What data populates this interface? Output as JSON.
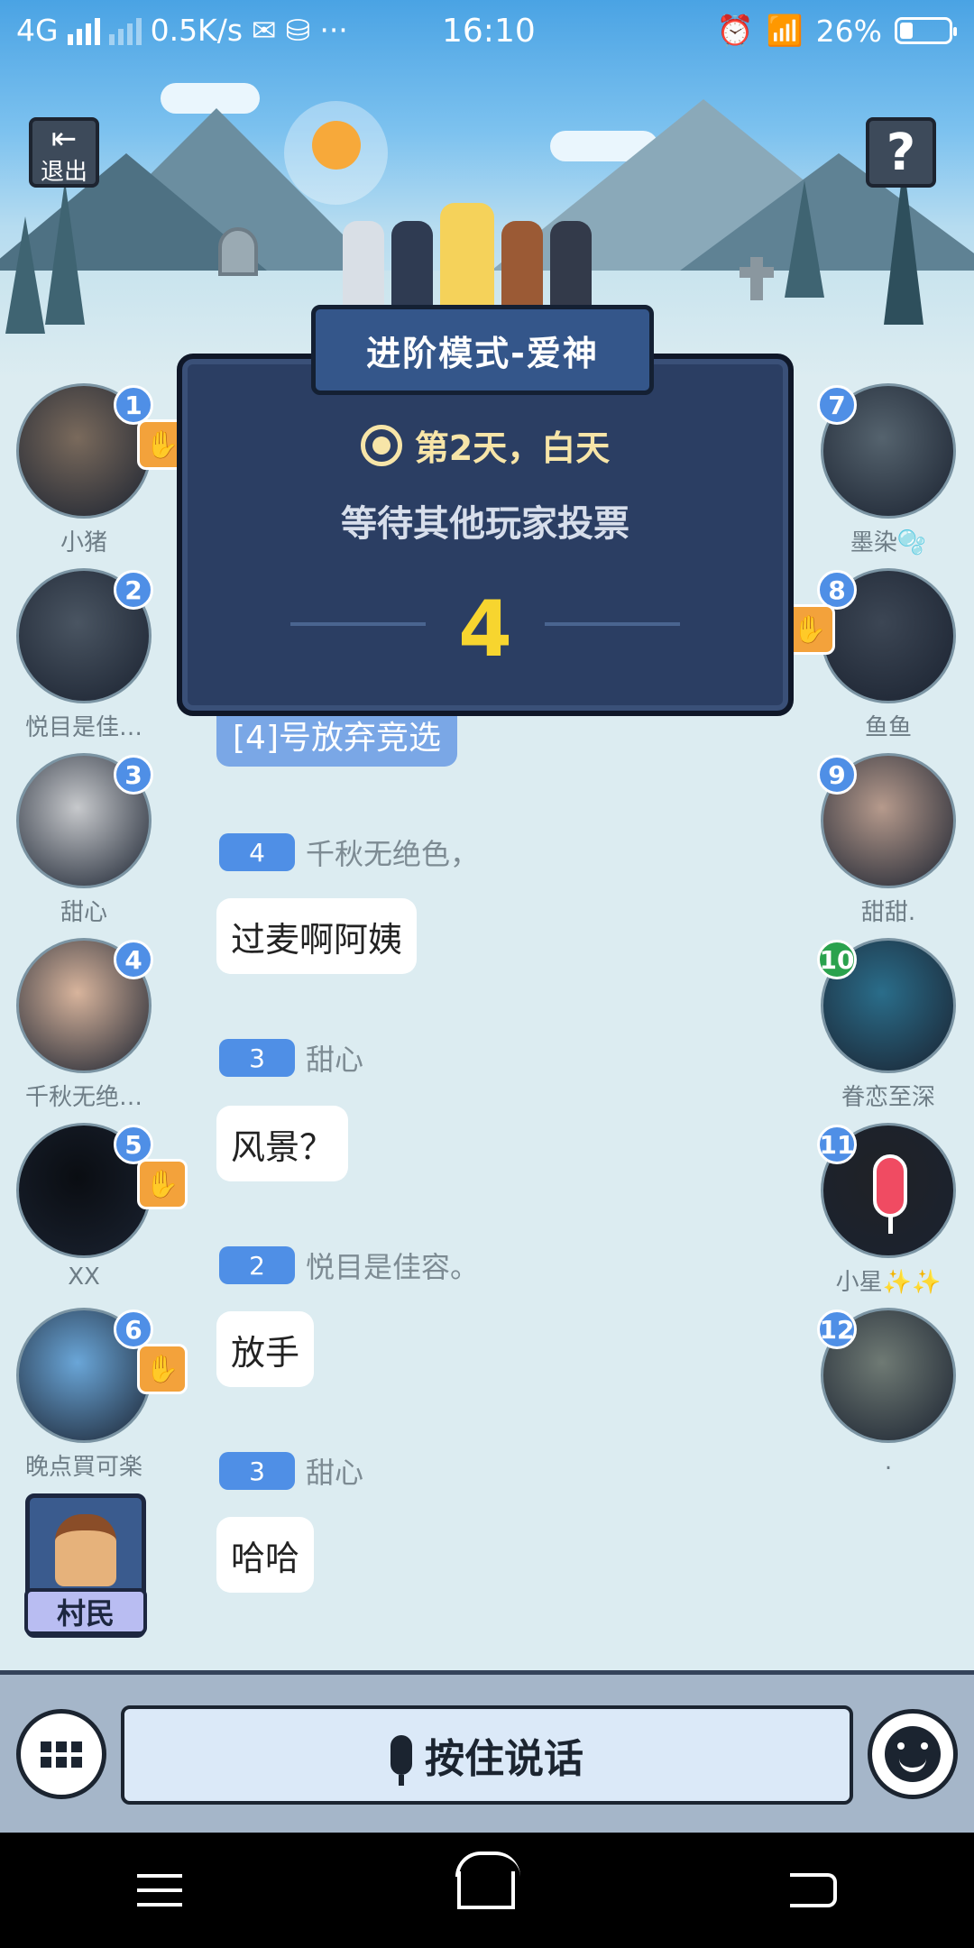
{
  "status_bar": {
    "network": "4G",
    "speed": "0.5K/s",
    "dots": "···",
    "time": "16:10",
    "battery": "26%"
  },
  "top": {
    "exit_label": "退出",
    "help_label": "?"
  },
  "mode": {
    "title": "进阶模式-爱神",
    "day": "第2天，白天",
    "status": "等待其他玩家投票",
    "countdown": "4"
  },
  "system_message": "[4]号放弃竞选",
  "messages": [
    {
      "seat": "4",
      "name": "千秋无绝色，",
      "text": "过麦啊阿姨"
    },
    {
      "seat": "3",
      "name": "甜心",
      "text": "风景？"
    },
    {
      "seat": "2",
      "name": "悦目是佳容。",
      "text": "放手"
    },
    {
      "seat": "3",
      "name": "甜心",
      "text": "哈哈"
    }
  ],
  "players_left": [
    {
      "seat": "1",
      "name": "小猪",
      "hand": true,
      "color": "#7a6a5c"
    },
    {
      "seat": "2",
      "name": "悦目是佳…",
      "hand": false,
      "color": "#4a5562"
    },
    {
      "seat": "3",
      "name": "甜心",
      "hand": false,
      "color": "#c7c9cc"
    },
    {
      "seat": "4",
      "name": "千秋无绝…",
      "hand": false,
      "color": "#d8b49c"
    },
    {
      "seat": "5",
      "name": "XX",
      "hand": true,
      "color": "#0a0d12"
    },
    {
      "seat": "6",
      "name": "晚点買可楽",
      "hand": true,
      "color": "#6aa6d8"
    }
  ],
  "players_right": [
    {
      "seat": "7",
      "name": "墨染🫧",
      "hand": false,
      "color": "#55636e"
    },
    {
      "seat": "8",
      "name": "鱼鱼",
      "hand": true,
      "color": "#3c4654"
    },
    {
      "seat": "9",
      "name": "甜甜.",
      "hand": false,
      "color": "#b69a8c"
    },
    {
      "seat": "10",
      "name": "眷恋至深",
      "hand": false,
      "color": "#2a6d8a"
    },
    {
      "seat": "11",
      "name": "小星✨✨",
      "hand": false,
      "color": "#202226"
    },
    {
      "seat": "12",
      "name": ".",
      "hand": false,
      "color": "#6f7a74"
    }
  ],
  "role": {
    "label": "村民"
  },
  "input": {
    "talk_label": "按住说话"
  }
}
